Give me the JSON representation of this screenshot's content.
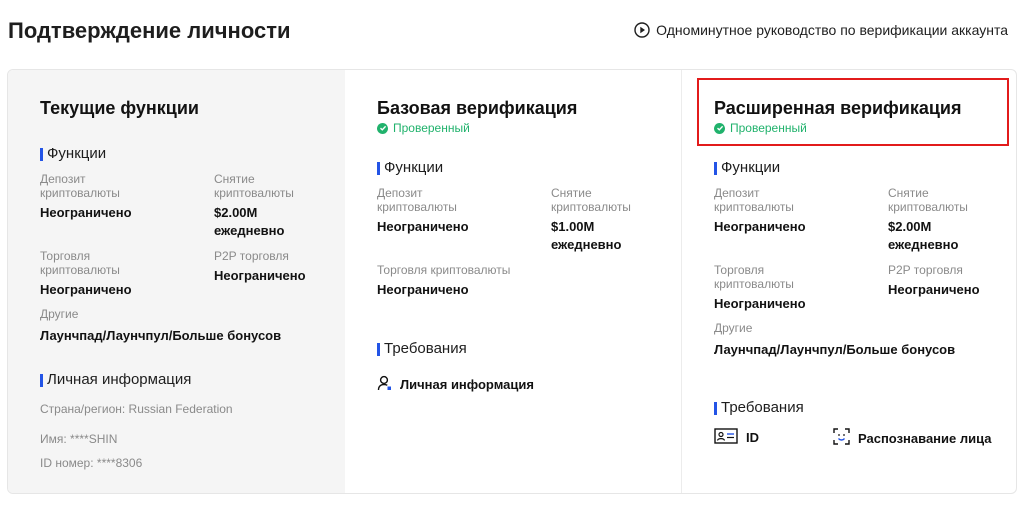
{
  "page": {
    "title": "Подтверждение личности",
    "guide_link": "Одноминутное руководство по верификации аккаунта"
  },
  "current": {
    "title": "Текущие функции",
    "features_head": "Функции",
    "deposit_label": "Депозит криптовалюты",
    "deposit_value": "Неограничено",
    "withdraw_label": "Снятие криптовалюты",
    "withdraw_value": "$2.00M ежедневно",
    "trade_label": "Торговля криптовалюты",
    "trade_value": "Неограничено",
    "p2p_label": "P2P торговля",
    "p2p_value": "Неограничено",
    "other_label": "Другие",
    "other_value": "Лаунчпад/Лаунчпул/Больше бонусов",
    "personal_head": "Личная информация",
    "country": "Страна/регион: Russian Federation",
    "name": "Имя: ****SHIN",
    "id_number": "ID номер: ****8306"
  },
  "basic": {
    "title": "Базовая верификация",
    "status": "Проверенный",
    "features_head": "Функции",
    "deposit_label": "Депозит криптовалюты",
    "deposit_value": "Неограничено",
    "withdraw_label": "Снятие криптовалюты",
    "withdraw_value": "$1.00M ежедневно",
    "trade_label": "Торговля криптовалюты",
    "trade_value": "Неограничено",
    "requirements_head": "Требования",
    "req_personal": "Личная информация"
  },
  "advanced": {
    "title": "Расширенная верификация",
    "status": "Проверенный",
    "features_head": "Функции",
    "deposit_label": "Депозит криптовалюты",
    "deposit_value": "Неограничено",
    "withdraw_label": "Снятие криптовалюты",
    "withdraw_value": "$2.00M ежедневно",
    "trade_label": "Торговля криптовалюты",
    "trade_value": "Неограничено",
    "p2p_label": "P2P торговля",
    "p2p_value": "Неограничено",
    "other_label": "Другие",
    "other_value": "Лаунчпад/Лаунчпул/Больше бонусов",
    "requirements_head": "Требования",
    "req_id": "ID",
    "req_face": "Распознавание лица"
  },
  "icons": {
    "play": "play-circle-icon",
    "check": "check-circle-icon",
    "person": "person-icon",
    "id_card": "id-card-icon",
    "face_scan": "face-scan-icon"
  },
  "colors": {
    "accent_bar": "#2354e6",
    "verified": "#20b26c",
    "highlight": "#e21b1b",
    "current_bg": "#f5f5f5"
  }
}
